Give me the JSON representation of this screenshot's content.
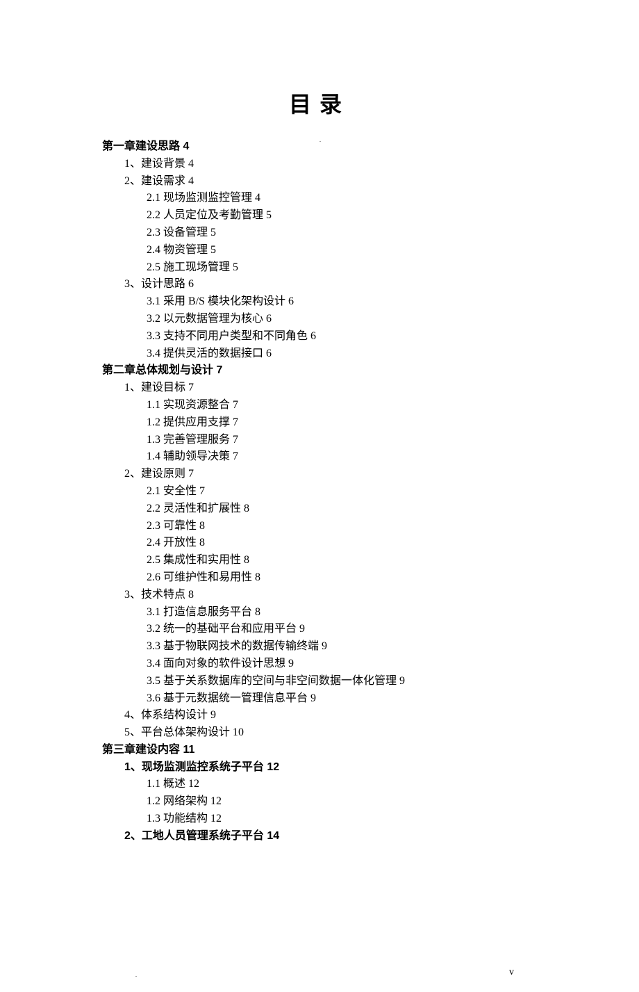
{
  "title": "目录",
  "footer": "v",
  "entries": [
    {
      "class": "chapter",
      "text": "第一章建设思路 4"
    },
    {
      "class": "section",
      "text": "1、建设背景 4"
    },
    {
      "class": "section",
      "text": "2、建设需求 4"
    },
    {
      "class": "subsection",
      "text": "2.1 现场监测监控管理 4"
    },
    {
      "class": "subsection",
      "text": "2.2 人员定位及考勤管理 5"
    },
    {
      "class": "subsection",
      "text": "2.3 设备管理 5"
    },
    {
      "class": "subsection",
      "text": "2.4 物资管理 5"
    },
    {
      "class": "subsection",
      "text": "2.5 施工现场管理 5"
    },
    {
      "class": "section",
      "text": "3、设计思路 6"
    },
    {
      "class": "subsection",
      "text": "3.1 采用 B/S 模块化架构设计 6"
    },
    {
      "class": "subsection",
      "text": "3.2 以元数据管理为核心 6"
    },
    {
      "class": "subsection",
      "text": "3.3 支持不同用户类型和不同角色 6"
    },
    {
      "class": "subsection",
      "text": "3.4 提供灵活的数据接口 6"
    },
    {
      "class": "chapter",
      "text": "第二章总体规划与设计 7"
    },
    {
      "class": "section",
      "text": "1、建设目标 7"
    },
    {
      "class": "subsection",
      "text": "1.1 实现资源整合 7"
    },
    {
      "class": "subsection",
      "text": "1.2 提供应用支撑 7"
    },
    {
      "class": "subsection",
      "text": "1.3 完善管理服务 7"
    },
    {
      "class": "subsection",
      "text": "1.4 辅助领导决策 7"
    },
    {
      "class": "section",
      "text": "2、建设原则 7"
    },
    {
      "class": "subsection",
      "text": "2.1 安全性 7"
    },
    {
      "class": "subsection",
      "text": "2.2 灵活性和扩展性 8"
    },
    {
      "class": "subsection",
      "text": "2.3 可靠性 8"
    },
    {
      "class": "subsection",
      "text": "2.4 开放性 8"
    },
    {
      "class": "subsection",
      "text": "2.5 集成性和实用性 8"
    },
    {
      "class": "subsection",
      "text": "2.6 可维护性和易用性 8"
    },
    {
      "class": "section",
      "text": "3、技术特点 8"
    },
    {
      "class": "subsection",
      "text": "3.1 打造信息服务平台 8"
    },
    {
      "class": "subsection",
      "text": "3.2 统一的基础平台和应用平台 9"
    },
    {
      "class": "subsection",
      "text": "3.3 基于物联网技术的数据传输终端 9"
    },
    {
      "class": "subsection",
      "text": "3.4 面向对象的软件设计思想 9"
    },
    {
      "class": "subsection",
      "text": "3.5 基于关系数据库的空间与非空间数据一体化管理 9"
    },
    {
      "class": "subsection",
      "text": "3.6 基于元数据统一管理信息平台 9"
    },
    {
      "class": "section",
      "text": "4、体系结构设计 9"
    },
    {
      "class": "section",
      "text": "5、平台总体架构设计 10"
    },
    {
      "class": "chapter-bold",
      "text": "第三章建设内容 11"
    },
    {
      "class": "section-bold",
      "text": "1、现场监测监控系统子平台 12"
    },
    {
      "class": "subsection",
      "text": "1.1 概述 12"
    },
    {
      "class": "subsection",
      "text": "1.2 网络架构 12"
    },
    {
      "class": "subsection",
      "text": "1.3 功能结构 12"
    },
    {
      "class": "section-bold",
      "text": "2、工地人员管理系统子平台 14"
    }
  ]
}
